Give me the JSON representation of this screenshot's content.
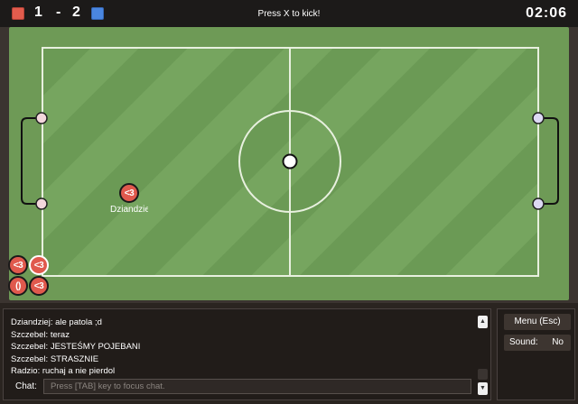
{
  "scoreboard": {
    "red_team_color": "#e25c4d",
    "blue_team_color": "#4a86e0",
    "red_score": "1",
    "separator": "-",
    "blue_score": "2",
    "hint": "Press X to kick!",
    "timer": "02:06"
  },
  "field": {
    "grass_dark": "#6b9a55",
    "grass_light": "#76a55f",
    "line_color": "#e8f0df"
  },
  "players": [
    {
      "label": "<3",
      "name": "Dziandziej"
    },
    {
      "label": "<3"
    },
    {
      "label": "<3"
    },
    {
      "label": "()"
    },
    {
      "label": "<3"
    }
  ],
  "chat": {
    "messages": [
      "Dziandziej: ale patola ;d",
      "Szczebel: teraz",
      "Szczebel: JESTEŚMY POJEBANI",
      "Szczebel: STRASZNIE",
      "Radzio: ruchaj a nie pierdol"
    ],
    "label": "Chat:",
    "placeholder": "Press [TAB] key to focus chat.",
    "scroll_up": "▲",
    "scroll_down": "▼"
  },
  "menu": {
    "menu_label": "Menu (Esc)",
    "sound_label": "Sound:",
    "sound_value": "No"
  }
}
